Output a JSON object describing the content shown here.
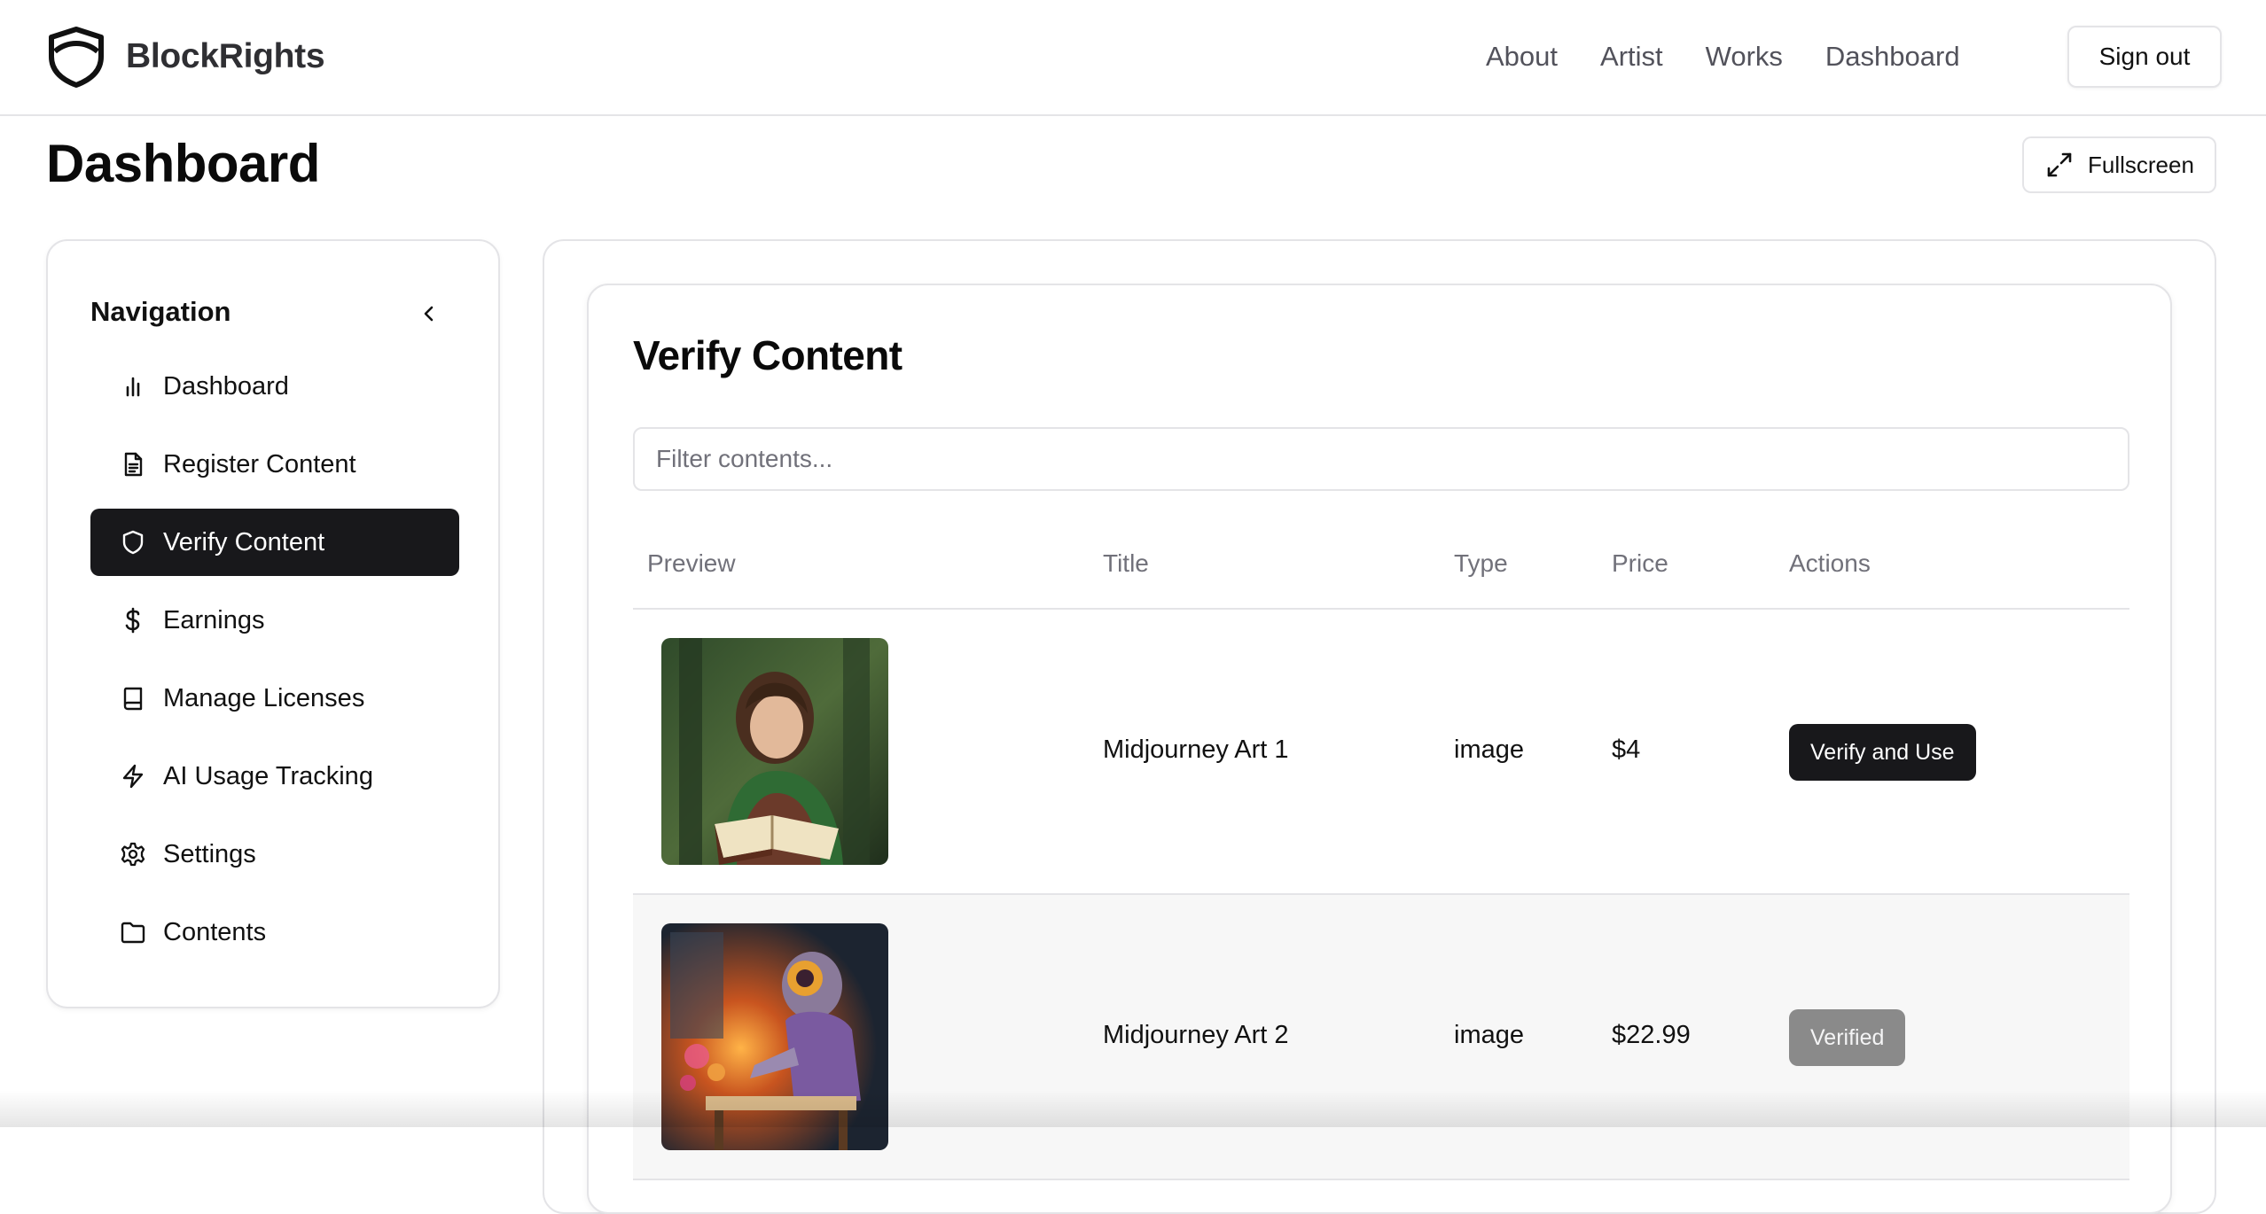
{
  "brand": {
    "name": "BlockRights",
    "logo_icon": "shield-logo-icon"
  },
  "header": {
    "nav": [
      "About",
      "Artist",
      "Works",
      "Dashboard"
    ],
    "signout_label": "Sign out"
  },
  "page": {
    "title": "Dashboard",
    "fullscreen_label": "Fullscreen",
    "fullscreen_icon": "expand-icon"
  },
  "sidebar": {
    "heading": "Navigation",
    "collapse_icon": "chevron-left-icon",
    "items": [
      {
        "label": "Dashboard",
        "icon": "bar-chart-icon",
        "active": false
      },
      {
        "label": "Register Content",
        "icon": "file-text-icon",
        "active": false
      },
      {
        "label": "Verify Content",
        "icon": "shield-icon",
        "active": true
      },
      {
        "label": "Earnings",
        "icon": "dollar-sign-icon",
        "active": false
      },
      {
        "label": "Manage Licenses",
        "icon": "book-icon",
        "active": false
      },
      {
        "label": "AI Usage Tracking",
        "icon": "zap-icon",
        "active": false
      },
      {
        "label": "Settings",
        "icon": "gear-icon",
        "active": false
      },
      {
        "label": "Contents",
        "icon": "folder-icon",
        "active": false
      }
    ]
  },
  "verify": {
    "title": "Verify Content",
    "filter_placeholder": "Filter contents...",
    "columns": [
      "Preview",
      "Title",
      "Type",
      "Price",
      "Actions"
    ],
    "rows": [
      {
        "title": "Midjourney Art 1",
        "type": "image",
        "price": "$4",
        "action": "Verify and Use",
        "verified": false
      },
      {
        "title": "Midjourney Art 2",
        "type": "image",
        "price": "$22.99",
        "action": "Verified",
        "verified": true
      }
    ]
  },
  "colors": {
    "primary": "#18181b",
    "border": "#e4e4e7",
    "muted_text": "#71717a",
    "verified_bg": "#8a8a8a"
  }
}
